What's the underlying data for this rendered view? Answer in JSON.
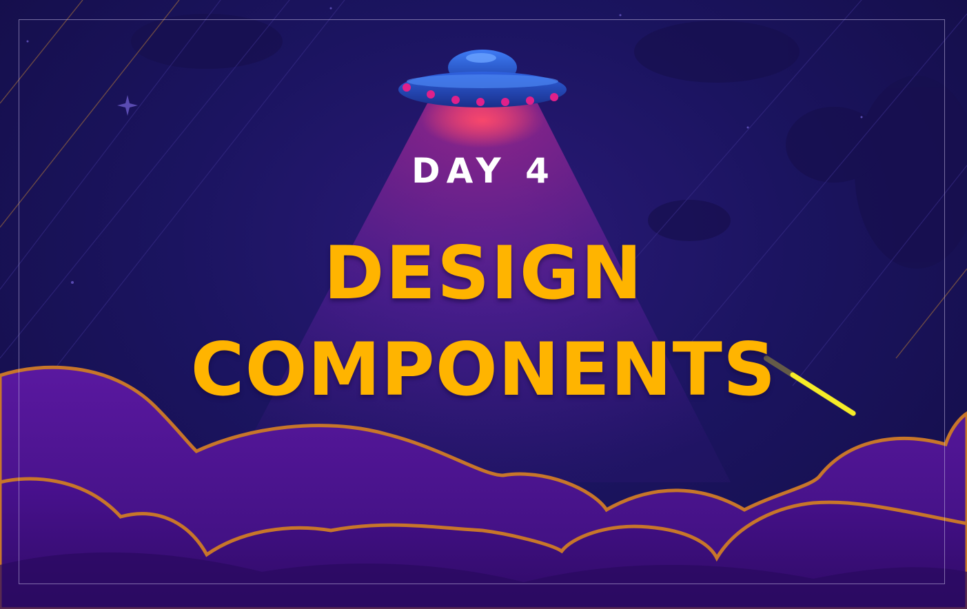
{
  "slide": {
    "day_label": "DAY 4",
    "title_line_1": "DESIGN",
    "title_line_2": "COMPONENTS"
  },
  "colors": {
    "background": "#1b1460",
    "title": "#ffb400",
    "day_label": "#ffffff",
    "cloud_fill": "#4a1390",
    "cloud_edge": "#c8762a",
    "ufo_body": "#2d5bd8",
    "ufo_lights": "#e0208a",
    "beam": "#7a2aa8",
    "comet": "#f0e020"
  },
  "icons": [
    "ufo-icon",
    "comet-icon",
    "star-icon"
  ]
}
